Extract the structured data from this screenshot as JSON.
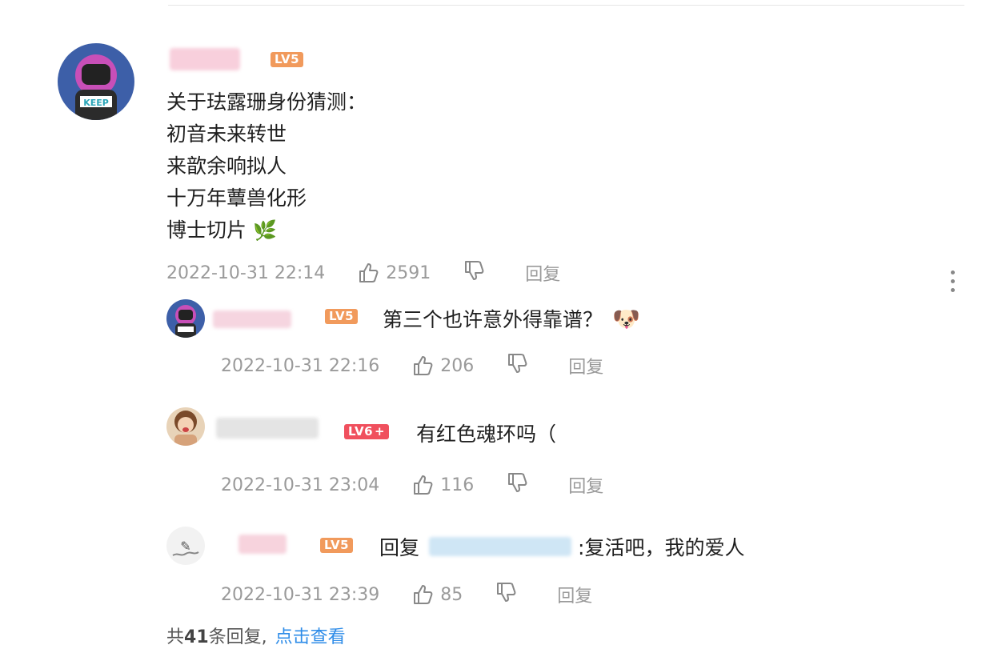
{
  "main_comment": {
    "level": "LV5",
    "lines": [
      "关于珐露珊身份猜测：",
      "初音未来转世",
      "来歆余响拟人",
      "十万年蕈兽化形",
      "博士切片"
    ],
    "emoji": "🌿",
    "time": "2022-10-31 22:14",
    "likes": "2591",
    "reply_label": "回复"
  },
  "replies": [
    {
      "level": "LV5",
      "text": "第三个也许意外得靠谱？",
      "emoji": "🐶",
      "time": "2022-10-31 22:16",
      "likes": "206",
      "reply_label": "回复"
    },
    {
      "level": "LV6",
      "level_suffix": "+",
      "text": "有红色魂环吗（",
      "time": "2022-10-31 23:04",
      "likes": "116",
      "reply_label": "回复"
    },
    {
      "level": "LV5",
      "prefix": "回复",
      "text": ":复活吧，我的爱人",
      "time": "2022-10-31 23:39",
      "likes": "85",
      "reply_label": "回复"
    }
  ],
  "footer": {
    "prefix": "共",
    "count": "41",
    "suffix": "条回复,",
    "link": "点击查看"
  },
  "colors": {
    "lv5": "#f19a5c",
    "lv6": "#f0505e",
    "link": "#2e8ce8",
    "meta": "#9a9a9a"
  }
}
